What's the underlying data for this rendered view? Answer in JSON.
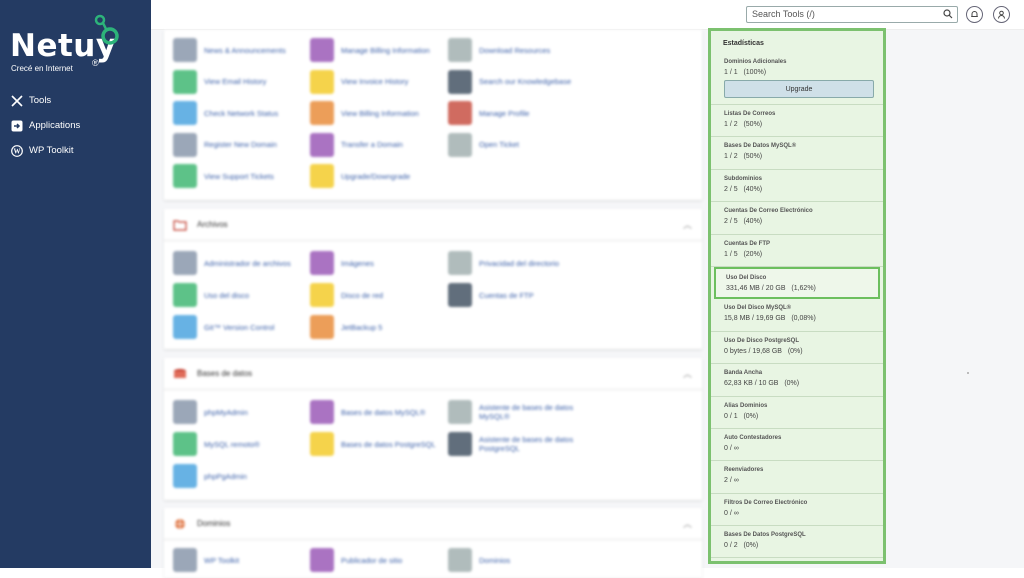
{
  "brand": {
    "name": "Netuy",
    "tagline": "Crecé en Internet",
    "reg": "®"
  },
  "sidebar": {
    "items": [
      {
        "label": "Tools",
        "icon": "tools-icon"
      },
      {
        "label": "Applications",
        "icon": "applications-icon"
      },
      {
        "label": "WP Toolkit",
        "icon": "wordpress-icon"
      }
    ]
  },
  "topbar": {
    "search_placeholder": "Search Tools (/)"
  },
  "billing": {
    "items": [
      [
        "News & Announcements",
        "Manage Billing Information",
        "Download Resources"
      ],
      [
        "View Email History",
        "View Invoice History",
        "Search our Knowledgebase"
      ],
      [
        "Check Network Status",
        "View Billing Information",
        "Manage Profile"
      ],
      [
        "Register New Domain",
        "Transfer a Domain",
        "Open Ticket"
      ],
      [
        "View Support Tickets",
        "Upgrade/Downgrade",
        ""
      ]
    ]
  },
  "files": {
    "title": "Archivos",
    "items": [
      [
        "Administrador de archivos",
        "Imágenes",
        "Privacidad del directorio"
      ],
      [
        "Uso del disco",
        "Disco de red",
        "Cuentas de FTP"
      ],
      [
        "Git™ Version Control",
        "JetBackup 5",
        ""
      ]
    ]
  },
  "databases": {
    "title": "Bases de datos",
    "items": [
      [
        "phpMyAdmin",
        "Bases de datos MySQL®",
        "Asistente de bases de datos MySQL®"
      ],
      [
        "MySQL remoto®",
        "Bases de datos PostgreSQL",
        "Asistente de bases de datos PostgreSQL"
      ],
      [
        "phpPgAdmin",
        "",
        ""
      ]
    ]
  },
  "domains": {
    "title": "Dominios",
    "items": [
      [
        "WP Toolkit",
        "Publicador de sitio",
        "Dominios"
      ]
    ]
  },
  "stats": {
    "title": "Estadísticas",
    "upgrade": "Upgrade",
    "items": [
      {
        "label": "Dominios Adicionales",
        "value": "1 / 1   (100%)"
      },
      {
        "label": "Listas De Correos",
        "value": "1 / 2   (50%)"
      },
      {
        "label": "Bases De Datos MySQL®",
        "value": "1 / 2   (50%)"
      },
      {
        "label": "Subdominios",
        "value": "2 / 5   (40%)"
      },
      {
        "label": "Cuentas De Correo Electrónico",
        "value": "2 / 5   (40%)"
      },
      {
        "label": "Cuentas De FTP",
        "value": "1 / 5   (20%)"
      },
      {
        "label": "Uso Del Disco",
        "value": "331,46 MB / 20 GB   (1,62%)"
      },
      {
        "label": "Uso Del Disco MySQL®",
        "value": "15,8 MB / 19,69 GB   (0,08%)"
      },
      {
        "label": "Uso De Disco PostgreSQL",
        "value": "0 bytes / 19,68 GB   (0%)"
      },
      {
        "label": "Banda Ancha",
        "value": "62,83 KB / 10 GB   (0%)"
      },
      {
        "label": "Alias Dominios",
        "value": "0 / 1   (0%)"
      },
      {
        "label": "Auto Contestadores",
        "value": "0 / ∞"
      },
      {
        "label": "Reenviadores",
        "value": "2 / ∞"
      },
      {
        "label": "Filtros De Correo Electrónico",
        "value": "0 / ∞"
      },
      {
        "label": "Bases De Datos PostgreSQL",
        "value": "0 / 2   (0%)"
      }
    ]
  },
  "colors": {
    "sidebar": "#243b63",
    "accent_green": "#7cc16f",
    "brand_green": "#2db37a"
  }
}
